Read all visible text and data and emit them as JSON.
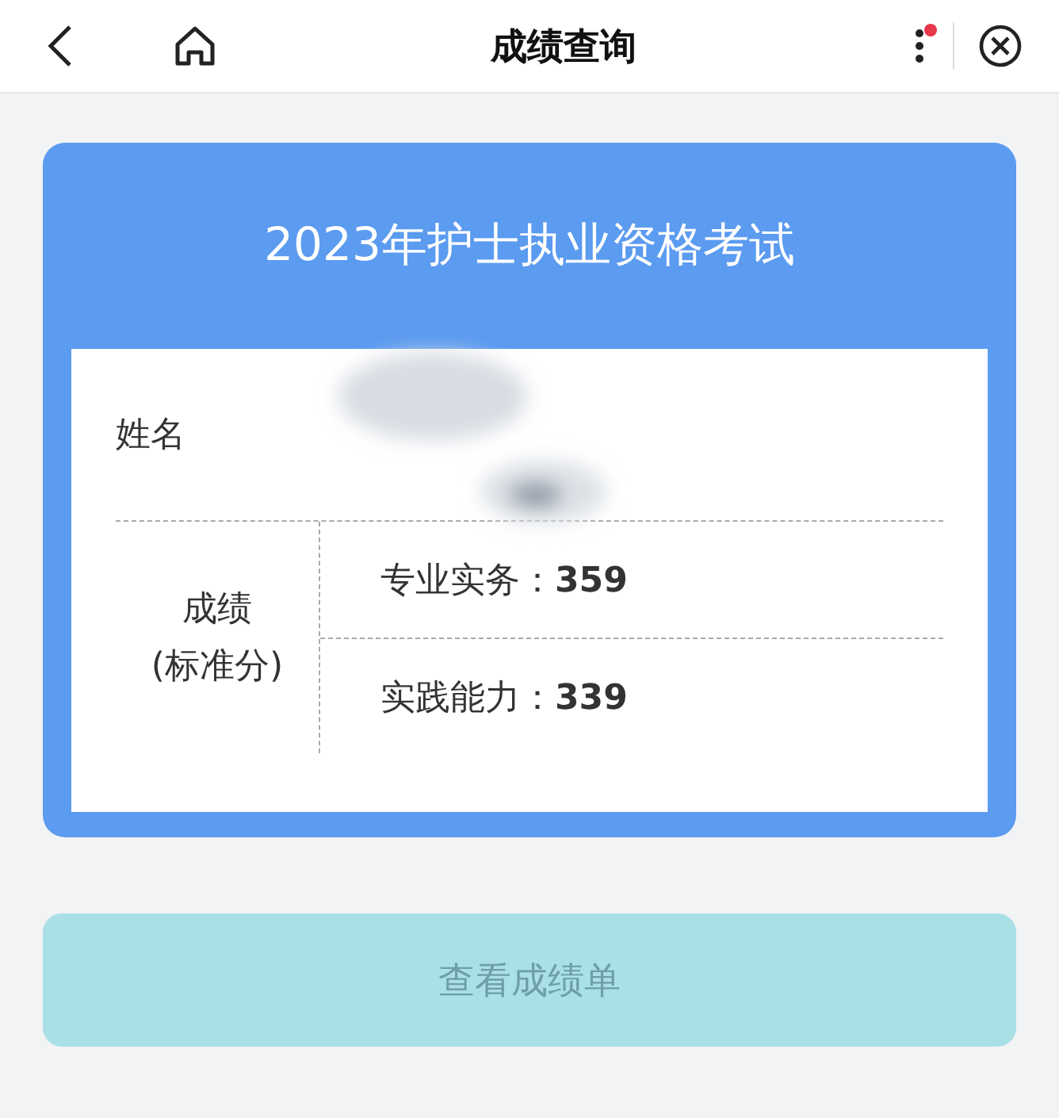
{
  "header": {
    "title": "成绩查询",
    "menu_badge": true
  },
  "card": {
    "title": "2023年护士执业资格考试",
    "name_label": "姓名",
    "score_label": [
      "成绩",
      "(标准分)"
    ],
    "scores": [
      {
        "label": "专业实务：",
        "value": "359"
      },
      {
        "label": "实践能力：",
        "value": "339"
      }
    ]
  },
  "button": {
    "label": "查看成绩单",
    "disabled": true
  }
}
